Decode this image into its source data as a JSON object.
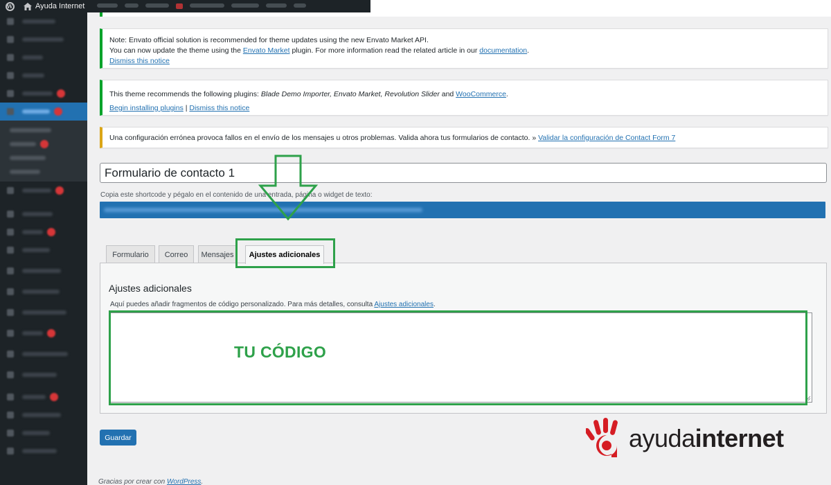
{
  "admin_bar": {
    "site_name": "Ayuda Internet"
  },
  "notices": {
    "envato": {
      "line1": "Note: Envato official solution is recommended for theme updates using the new Envato Market API.",
      "line2_pre": "You can now update the theme using the ",
      "line2_link1": "Envato Market",
      "line2_mid": " plugin. For more information read the related article in our ",
      "line2_link2": "documentation",
      "line2_post": ".",
      "dismiss": "Dismiss this notice"
    },
    "plugins": {
      "text_pre": "This theme recommends the following plugins: ",
      "plugins_list": "Blade Demo Importer, Envato Market, Revolution Slider",
      "and": " and ",
      "woocommerce": "WooCommerce",
      "post": ".",
      "begin_installing": "Begin installing plugins",
      "separator": " | ",
      "dismiss": "Dismiss this notice"
    },
    "cf7": {
      "text": "Una configuración errónea provoca fallos en el envío de los mensajes u otros problemas. Valida ahora tus formularios de contacto. » ",
      "link": "Validar la configuración de Contact Form 7"
    }
  },
  "form": {
    "title_value": "Formulario de contacto 1",
    "shortcode_label": "Copia este shortcode y pégalo en el contenido de una entrada, página o widget de texto:"
  },
  "tabs": [
    {
      "label": "Formulario"
    },
    {
      "label": "Correo"
    },
    {
      "label": "Mensajes"
    },
    {
      "label": "Ajustes adicionales"
    }
  ],
  "panel": {
    "title": "Ajustes adicionales",
    "desc_pre": "Aquí puedes añadir fragmentos de código personalizado. Para más detalles, consulta ",
    "desc_link": "Ajustes adicionales",
    "desc_post": ".",
    "code_label": "TU CÓDIGO"
  },
  "save_label": "Guardar",
  "footer": {
    "pre": "Gracias por crear con ",
    "link": "WordPress",
    "post": "."
  },
  "logo": {
    "part1": "ayuda",
    "part2": "internet"
  },
  "colors": {
    "highlight_green": "#2ea14a",
    "wp_blue": "#2271b1",
    "logo_red": "#d51d24",
    "sidebar_bg": "#1d2327"
  }
}
